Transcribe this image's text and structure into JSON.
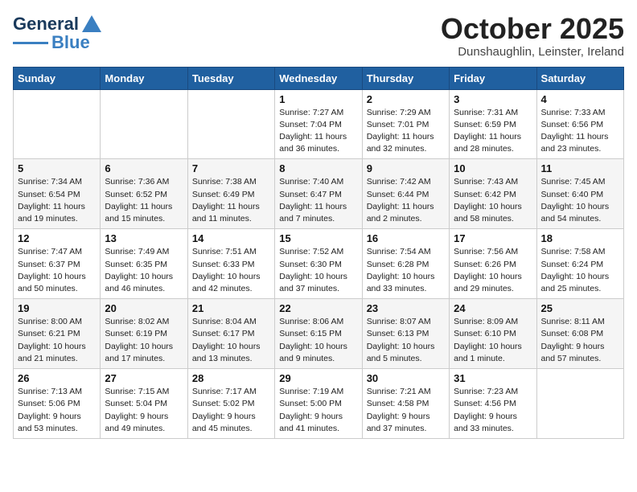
{
  "logo": {
    "line1": "General",
    "line2": "Blue"
  },
  "title": "October 2025",
  "subtitle": "Dunshaughlin, Leinster, Ireland",
  "days_of_week": [
    "Sunday",
    "Monday",
    "Tuesday",
    "Wednesday",
    "Thursday",
    "Friday",
    "Saturday"
  ],
  "weeks": [
    [
      {
        "day": "",
        "info": ""
      },
      {
        "day": "",
        "info": ""
      },
      {
        "day": "",
        "info": ""
      },
      {
        "day": "1",
        "info": "Sunrise: 7:27 AM\nSunset: 7:04 PM\nDaylight: 11 hours\nand 36 minutes."
      },
      {
        "day": "2",
        "info": "Sunrise: 7:29 AM\nSunset: 7:01 PM\nDaylight: 11 hours\nand 32 minutes."
      },
      {
        "day": "3",
        "info": "Sunrise: 7:31 AM\nSunset: 6:59 PM\nDaylight: 11 hours\nand 28 minutes."
      },
      {
        "day": "4",
        "info": "Sunrise: 7:33 AM\nSunset: 6:56 PM\nDaylight: 11 hours\nand 23 minutes."
      }
    ],
    [
      {
        "day": "5",
        "info": "Sunrise: 7:34 AM\nSunset: 6:54 PM\nDaylight: 11 hours\nand 19 minutes."
      },
      {
        "day": "6",
        "info": "Sunrise: 7:36 AM\nSunset: 6:52 PM\nDaylight: 11 hours\nand 15 minutes."
      },
      {
        "day": "7",
        "info": "Sunrise: 7:38 AM\nSunset: 6:49 PM\nDaylight: 11 hours\nand 11 minutes."
      },
      {
        "day": "8",
        "info": "Sunrise: 7:40 AM\nSunset: 6:47 PM\nDaylight: 11 hours\nand 7 minutes."
      },
      {
        "day": "9",
        "info": "Sunrise: 7:42 AM\nSunset: 6:44 PM\nDaylight: 11 hours\nand 2 minutes."
      },
      {
        "day": "10",
        "info": "Sunrise: 7:43 AM\nSunset: 6:42 PM\nDaylight: 10 hours\nand 58 minutes."
      },
      {
        "day": "11",
        "info": "Sunrise: 7:45 AM\nSunset: 6:40 PM\nDaylight: 10 hours\nand 54 minutes."
      }
    ],
    [
      {
        "day": "12",
        "info": "Sunrise: 7:47 AM\nSunset: 6:37 PM\nDaylight: 10 hours\nand 50 minutes."
      },
      {
        "day": "13",
        "info": "Sunrise: 7:49 AM\nSunset: 6:35 PM\nDaylight: 10 hours\nand 46 minutes."
      },
      {
        "day": "14",
        "info": "Sunrise: 7:51 AM\nSunset: 6:33 PM\nDaylight: 10 hours\nand 42 minutes."
      },
      {
        "day": "15",
        "info": "Sunrise: 7:52 AM\nSunset: 6:30 PM\nDaylight: 10 hours\nand 37 minutes."
      },
      {
        "day": "16",
        "info": "Sunrise: 7:54 AM\nSunset: 6:28 PM\nDaylight: 10 hours\nand 33 minutes."
      },
      {
        "day": "17",
        "info": "Sunrise: 7:56 AM\nSunset: 6:26 PM\nDaylight: 10 hours\nand 29 minutes."
      },
      {
        "day": "18",
        "info": "Sunrise: 7:58 AM\nSunset: 6:24 PM\nDaylight: 10 hours\nand 25 minutes."
      }
    ],
    [
      {
        "day": "19",
        "info": "Sunrise: 8:00 AM\nSunset: 6:21 PM\nDaylight: 10 hours\nand 21 minutes."
      },
      {
        "day": "20",
        "info": "Sunrise: 8:02 AM\nSunset: 6:19 PM\nDaylight: 10 hours\nand 17 minutes."
      },
      {
        "day": "21",
        "info": "Sunrise: 8:04 AM\nSunset: 6:17 PM\nDaylight: 10 hours\nand 13 minutes."
      },
      {
        "day": "22",
        "info": "Sunrise: 8:06 AM\nSunset: 6:15 PM\nDaylight: 10 hours\nand 9 minutes."
      },
      {
        "day": "23",
        "info": "Sunrise: 8:07 AM\nSunset: 6:13 PM\nDaylight: 10 hours\nand 5 minutes."
      },
      {
        "day": "24",
        "info": "Sunrise: 8:09 AM\nSunset: 6:10 PM\nDaylight: 10 hours\nand 1 minute."
      },
      {
        "day": "25",
        "info": "Sunrise: 8:11 AM\nSunset: 6:08 PM\nDaylight: 9 hours\nand 57 minutes."
      }
    ],
    [
      {
        "day": "26",
        "info": "Sunrise: 7:13 AM\nSunset: 5:06 PM\nDaylight: 9 hours\nand 53 minutes."
      },
      {
        "day": "27",
        "info": "Sunrise: 7:15 AM\nSunset: 5:04 PM\nDaylight: 9 hours\nand 49 minutes."
      },
      {
        "day": "28",
        "info": "Sunrise: 7:17 AM\nSunset: 5:02 PM\nDaylight: 9 hours\nand 45 minutes."
      },
      {
        "day": "29",
        "info": "Sunrise: 7:19 AM\nSunset: 5:00 PM\nDaylight: 9 hours\nand 41 minutes."
      },
      {
        "day": "30",
        "info": "Sunrise: 7:21 AM\nSunset: 4:58 PM\nDaylight: 9 hours\nand 37 minutes."
      },
      {
        "day": "31",
        "info": "Sunrise: 7:23 AM\nSunset: 4:56 PM\nDaylight: 9 hours\nand 33 minutes."
      },
      {
        "day": "",
        "info": ""
      }
    ]
  ]
}
